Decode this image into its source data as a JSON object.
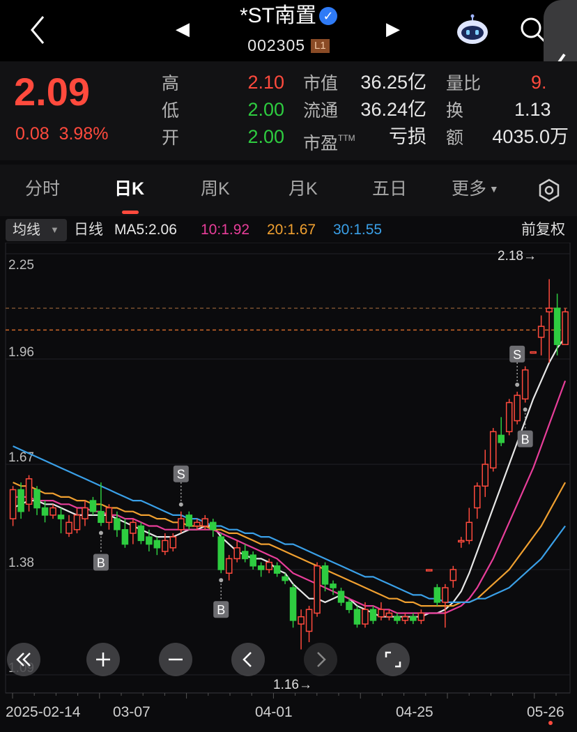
{
  "header": {
    "stock_name": "*ST南置",
    "verified_icon": "verified-check-icon",
    "code": "002305",
    "level": "L1",
    "icons": [
      "back-arrow-icon",
      "prev-stock-icon",
      "next-stock-icon",
      "robot-assistant-icon",
      "search-icon",
      "side-drawer-icon"
    ]
  },
  "quote": {
    "price": "2.09",
    "change": "0.08",
    "change_pct": "3.98%",
    "high_label": "高",
    "high": "2.10",
    "low_label": "低",
    "low": "2.00",
    "open_label": "开",
    "open": "2.00",
    "mktcap_label": "市值",
    "mktcap": "36.25亿",
    "float_label": "流通",
    "float": "36.24亿",
    "pe_label": "市盈",
    "pe_sup": "TTM",
    "pe": "亏损",
    "volratio_label": "量比",
    "volratio": "9.",
    "turnover_label": "换",
    "turnover": "1.13",
    "amount_label": "额",
    "amount": "4035.0万",
    "colors": {
      "up": "#ff4a3d",
      "down": "#2ecc40"
    }
  },
  "tabs": {
    "items": [
      "分时",
      "日K",
      "周K",
      "月K",
      "五日",
      "更多"
    ],
    "active": "日K",
    "settings_icon": "hexagon-settings-icon"
  },
  "ma_bar": {
    "selector": "均线",
    "period": "日线",
    "ma5": "MA5:2.06",
    "ma10": "10:1.92",
    "ma20": "20:1.67",
    "ma30": "30:1.55",
    "adjust": "前复权",
    "colors": {
      "ma5": "#e8e8e8",
      "ma10": "#e83e9a",
      "ma20": "#f0a030",
      "ma30": "#3aa0e8"
    }
  },
  "chart_data": {
    "type": "candlestick",
    "y_ticks": [
      "2.25",
      "1.96",
      "1.67",
      "1.38",
      "1.09"
    ],
    "ylim": [
      1.09,
      2.25
    ],
    "x_ticks": [
      "2025-02-14",
      "03-07",
      "04-01",
      "04-25",
      "05-26"
    ],
    "annotation_high": "2.18→",
    "annotation_low": "1.16→",
    "dashed_levels": [
      2.1,
      2.04
    ],
    "markers": [
      {
        "label": "B",
        "index": 11
      },
      {
        "label": "S",
        "index": 21
      },
      {
        "label": "B",
        "index": 26
      },
      {
        "label": "S",
        "index": 63
      },
      {
        "label": "B",
        "index": 64
      }
    ],
    "candles": [
      [
        1.52,
        1.6,
        1.61,
        1.5
      ],
      [
        1.6,
        1.54,
        1.62,
        1.52
      ],
      [
        1.56,
        1.63,
        1.64,
        1.54
      ],
      [
        1.6,
        1.55,
        1.61,
        1.53
      ],
      [
        1.55,
        1.53,
        1.57,
        1.51
      ],
      [
        1.53,
        1.55,
        1.56,
        1.52
      ],
      [
        1.53,
        1.52,
        1.55,
        1.48
      ],
      [
        1.48,
        1.51,
        1.53,
        1.47
      ],
      [
        1.49,
        1.53,
        1.55,
        1.48
      ],
      [
        1.52,
        1.55,
        1.57,
        1.5
      ],
      [
        1.57,
        1.54,
        1.58,
        1.53
      ],
      [
        1.54,
        1.51,
        1.62,
        1.5
      ],
      [
        1.51,
        1.55,
        1.56,
        1.49
      ],
      [
        1.52,
        1.49,
        1.54,
        1.47
      ],
      [
        1.49,
        1.45,
        1.52,
        1.44
      ],
      [
        1.48,
        1.51,
        1.52,
        1.45
      ],
      [
        1.5,
        1.46,
        1.51,
        1.45
      ],
      [
        1.47,
        1.45,
        1.49,
        1.43
      ],
      [
        1.46,
        1.44,
        1.47,
        1.42
      ],
      [
        1.43,
        1.46,
        1.48,
        1.42
      ],
      [
        1.44,
        1.47,
        1.48,
        1.43
      ],
      [
        1.49,
        1.52,
        1.54,
        1.48
      ],
      [
        1.53,
        1.5,
        1.54,
        1.49
      ],
      [
        1.5,
        1.51,
        1.52,
        1.49
      ],
      [
        1.5,
        1.52,
        1.53,
        1.49
      ],
      [
        1.51,
        1.49,
        1.52,
        1.47
      ],
      [
        1.47,
        1.38,
        1.48,
        1.37
      ],
      [
        1.37,
        1.41,
        1.42,
        1.35
      ],
      [
        1.41,
        1.44,
        1.46,
        1.4
      ],
      [
        1.43,
        1.41,
        1.45,
        1.4
      ],
      [
        1.42,
        1.39,
        1.43,
        1.38
      ],
      [
        1.39,
        1.38,
        1.4,
        1.36
      ],
      [
        1.38,
        1.4,
        1.41,
        1.37
      ],
      [
        1.39,
        1.37,
        1.4,
        1.36
      ],
      [
        1.36,
        1.35,
        1.37,
        1.34
      ],
      [
        1.33,
        1.24,
        1.34,
        1.22
      ],
      [
        1.23,
        1.25,
        1.27,
        1.16
      ],
      [
        1.21,
        1.27,
        1.28,
        1.18
      ],
      [
        1.26,
        1.39,
        1.4,
        1.25
      ],
      [
        1.39,
        1.34,
        1.4,
        1.32
      ],
      [
        1.34,
        1.33,
        1.35,
        1.31
      ],
      [
        1.32,
        1.29,
        1.33,
        1.28
      ],
      [
        1.29,
        1.27,
        1.3,
        1.26
      ],
      [
        1.27,
        1.23,
        1.28,
        1.22
      ],
      [
        1.23,
        1.27,
        1.29,
        1.22
      ],
      [
        1.27,
        1.24,
        1.28,
        1.23
      ],
      [
        1.25,
        1.27,
        1.29,
        1.24
      ],
      [
        1.25,
        1.26,
        1.27,
        1.24
      ],
      [
        1.25,
        1.24,
        1.26,
        1.23
      ],
      [
        1.24,
        1.25,
        1.26,
        1.23
      ],
      [
        1.25,
        1.24,
        1.26,
        1.23
      ],
      [
        1.24,
        1.26,
        1.27,
        1.23
      ],
      [
        1.38,
        1.38,
        1.38,
        1.38
      ],
      [
        1.33,
        1.29,
        1.34,
        1.28
      ],
      [
        1.29,
        1.33,
        1.34,
        1.22
      ],
      [
        1.35,
        1.38,
        1.39,
        1.33
      ],
      [
        1.46,
        1.46,
        1.47,
        1.44
      ],
      [
        1.46,
        1.51,
        1.55,
        1.45
      ],
      [
        1.55,
        1.61,
        1.62,
        1.52
      ],
      [
        1.61,
        1.67,
        1.71,
        1.58
      ],
      [
        1.66,
        1.76,
        1.77,
        1.65
      ],
      [
        1.75,
        1.73,
        1.8,
        1.72
      ],
      [
        1.76,
        1.84,
        1.85,
        1.75
      ],
      [
        1.79,
        1.86,
        1.87,
        1.78
      ],
      [
        1.85,
        1.93,
        1.94,
        1.84
      ],
      [
        1.98,
        1.98,
        1.98,
        1.98
      ],
      [
        2.02,
        2.05,
        2.08,
        1.97
      ],
      [
        2.09,
        2.1,
        2.18,
        1.95
      ],
      [
        2.1,
        2.0,
        2.14,
        1.97
      ],
      [
        2.0,
        2.09,
        2.1,
        2.0
      ]
    ],
    "ma_series": [
      {
        "name": "MA5",
        "color": "#e8e8e8",
        "values": [
          1.55,
          1.56,
          1.57,
          1.57,
          1.56,
          1.56,
          1.55,
          1.54,
          1.53,
          1.53,
          1.53,
          1.53,
          1.53,
          1.52,
          1.51,
          1.5,
          1.49,
          1.48,
          1.47,
          1.47,
          1.47,
          1.48,
          1.49,
          1.49,
          1.5,
          1.5,
          1.47,
          1.45,
          1.43,
          1.42,
          1.41,
          1.41,
          1.4,
          1.38,
          1.37,
          1.34,
          1.32,
          1.3,
          1.3,
          1.29,
          1.3,
          1.31,
          1.3,
          1.28,
          1.27,
          1.26,
          1.25,
          1.25,
          1.25,
          1.25,
          1.25,
          1.25,
          1.26,
          1.26,
          1.27,
          1.29,
          1.32,
          1.37,
          1.43,
          1.49,
          1.55,
          1.61,
          1.67,
          1.73,
          1.79,
          1.85,
          1.9,
          1.95,
          1.99,
          2.02
        ]
      },
      {
        "name": "MA10",
        "color": "#e83e9a",
        "values": [
          1.58,
          1.58,
          1.58,
          1.57,
          1.57,
          1.57,
          1.56,
          1.56,
          1.55,
          1.55,
          1.54,
          1.54,
          1.53,
          1.53,
          1.52,
          1.52,
          1.51,
          1.5,
          1.5,
          1.49,
          1.49,
          1.49,
          1.49,
          1.49,
          1.49,
          1.49,
          1.48,
          1.47,
          1.46,
          1.45,
          1.44,
          1.43,
          1.42,
          1.41,
          1.39,
          1.37,
          1.36,
          1.35,
          1.34,
          1.33,
          1.32,
          1.31,
          1.3,
          1.29,
          1.28,
          1.28,
          1.27,
          1.27,
          1.26,
          1.26,
          1.26,
          1.26,
          1.26,
          1.26,
          1.26,
          1.27,
          1.28,
          1.3,
          1.33,
          1.37,
          1.41,
          1.46,
          1.51,
          1.56,
          1.61,
          1.66,
          1.72,
          1.78,
          1.84,
          1.9
        ]
      },
      {
        "name": "MA20",
        "color": "#f0a030",
        "values": [
          1.62,
          1.61,
          1.61,
          1.6,
          1.59,
          1.59,
          1.58,
          1.58,
          1.57,
          1.57,
          1.56,
          1.56,
          1.55,
          1.55,
          1.54,
          1.54,
          1.53,
          1.53,
          1.52,
          1.52,
          1.51,
          1.51,
          1.5,
          1.5,
          1.5,
          1.49,
          1.49,
          1.48,
          1.48,
          1.47,
          1.46,
          1.45,
          1.45,
          1.44,
          1.43,
          1.42,
          1.41,
          1.4,
          1.39,
          1.38,
          1.37,
          1.36,
          1.35,
          1.34,
          1.33,
          1.32,
          1.31,
          1.3,
          1.3,
          1.29,
          1.29,
          1.28,
          1.28,
          1.28,
          1.28,
          1.28,
          1.29,
          1.29,
          1.3,
          1.32,
          1.34,
          1.36,
          1.38,
          1.41,
          1.44,
          1.47,
          1.5,
          1.54,
          1.58,
          1.62
        ]
      },
      {
        "name": "MA30",
        "color": "#3aa0e8",
        "values": [
          1.72,
          1.71,
          1.7,
          1.69,
          1.68,
          1.67,
          1.66,
          1.65,
          1.64,
          1.63,
          1.62,
          1.61,
          1.6,
          1.59,
          1.58,
          1.57,
          1.57,
          1.56,
          1.55,
          1.54,
          1.53,
          1.53,
          1.52,
          1.52,
          1.51,
          1.5,
          1.5,
          1.49,
          1.49,
          1.48,
          1.48,
          1.47,
          1.47,
          1.46,
          1.45,
          1.45,
          1.44,
          1.43,
          1.42,
          1.41,
          1.4,
          1.39,
          1.38,
          1.37,
          1.36,
          1.36,
          1.35,
          1.34,
          1.33,
          1.32,
          1.31,
          1.31,
          1.3,
          1.3,
          1.29,
          1.29,
          1.29,
          1.29,
          1.3,
          1.3,
          1.31,
          1.32,
          1.33,
          1.35,
          1.37,
          1.39,
          1.41,
          1.44,
          1.47,
          1.5
        ]
      }
    ]
  },
  "float_controls": {
    "icons": [
      "rewind-icon",
      "zoom-in-icon",
      "zoom-out-icon",
      "scroll-left-icon",
      "scroll-right-icon",
      "fullscreen-icon"
    ]
  }
}
